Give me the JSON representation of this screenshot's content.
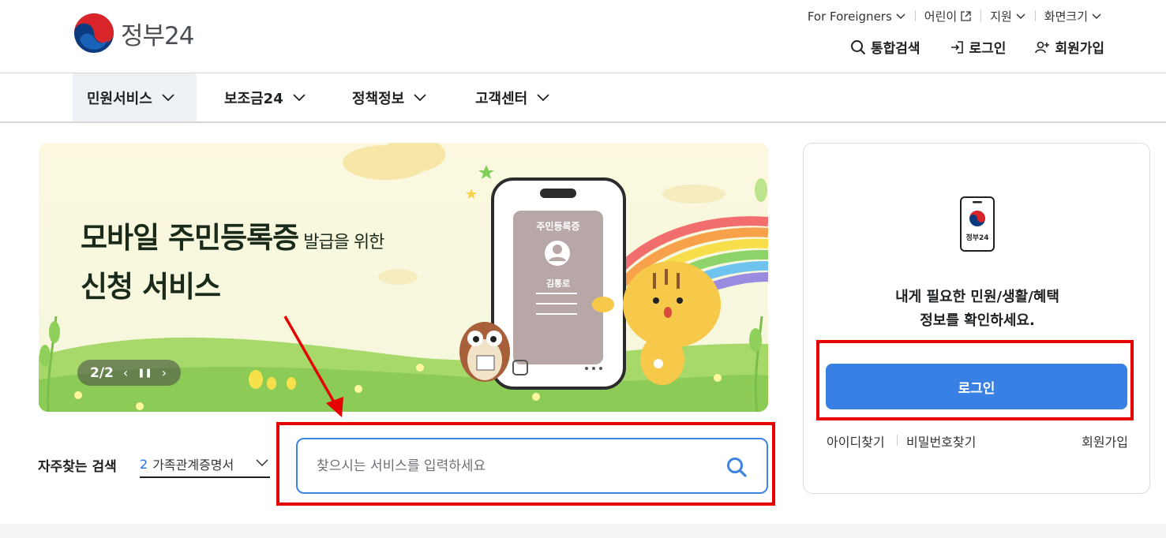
{
  "header": {
    "logo_text": "정부24",
    "util_nav": [
      {
        "label": "For Foreigners",
        "icon": "chevron-down-icon"
      },
      {
        "label": "어린이",
        "icon": "external-link-icon"
      },
      {
        "label": "지원",
        "icon": "chevron-down-icon"
      },
      {
        "label": "화면크기",
        "icon": "chevron-down-icon"
      }
    ],
    "actions": {
      "search": "통합검색",
      "login": "로그인",
      "signup": "회원가입"
    }
  },
  "gnb": {
    "items": [
      "민원서비스",
      "보조금24",
      "정책정보",
      "고객센터"
    ],
    "active_index": 0
  },
  "banner": {
    "title_main": "모바일 주민등록증",
    "title_small": "발급을 위한",
    "title_line2": "신청 서비스",
    "card_title": "주민등록증",
    "card_name": "김통로",
    "pager": {
      "current": "2",
      "total": "2",
      "label": "2/2"
    }
  },
  "search": {
    "freq_label": "자주찾는 검색",
    "freq_selected_num": "2",
    "freq_selected_text": "가족관계증명서",
    "placeholder": "찾으시는 서비스를 입력하세요"
  },
  "login_panel": {
    "logo_text": "정부24",
    "desc_line1": "내게 필요한 민원/생활/혜택",
    "desc_line2": "정보를 확인하세요.",
    "login_button": "로그인",
    "find_id": "아이디찾기",
    "find_pw": "비밀번호찾기",
    "signup": "회원가입"
  },
  "colors": {
    "primary_blue": "#3980e4",
    "search_border": "#3d83e0",
    "annotation_red": "#e60000",
    "gnb_active_bg": "#eef1f6"
  }
}
